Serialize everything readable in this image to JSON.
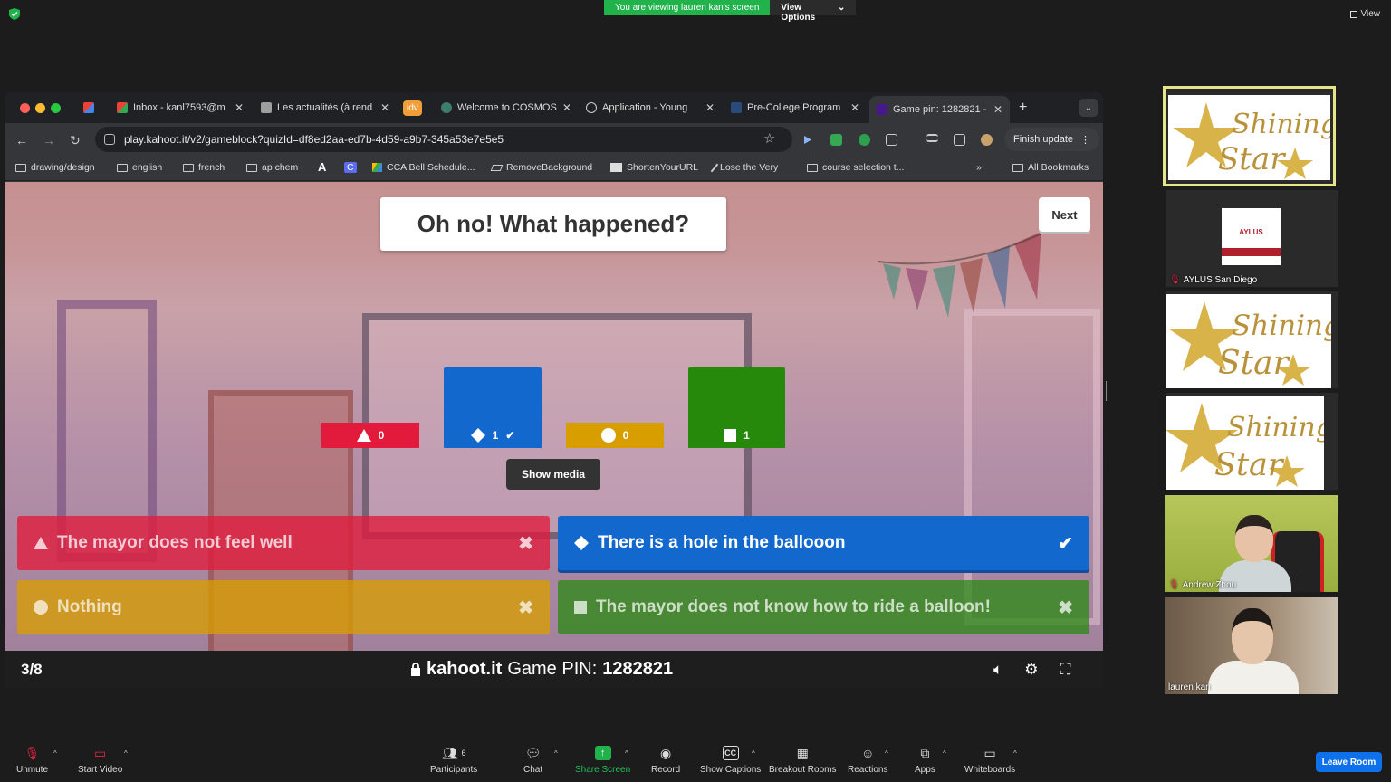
{
  "zoom_top": {
    "viewing_text": "You are viewing lauren kan's screen",
    "view_options": "View Options",
    "view_label": "View"
  },
  "browser": {
    "tabs": [
      {
        "label": "",
        "icon": "gmail-icon"
      },
      {
        "label": "Inbox - kanl7593@m",
        "icon": "gmail-icon"
      },
      {
        "label": "Les actualités (à rend",
        "icon": "classroom-icon"
      },
      {
        "label": "idv",
        "icon": "idv-icon"
      },
      {
        "label": "Welcome to COSMOS",
        "icon": "cosmos-icon"
      },
      {
        "label": "Application - Young",
        "icon": "globe-icon"
      },
      {
        "label": "Pre-College Program",
        "icon": "page-icon"
      },
      {
        "label": "Game pin: 1282821 -",
        "icon": "kahoot-icon"
      }
    ],
    "url": "play.kahoot.it/v2/gameblock?quizId=df8ed2aa-ed7b-4d59-a9b7-345a53e7e5e5",
    "finish_update": "Finish update",
    "bookmarks": [
      "drawing/design",
      "english",
      "french",
      "ap chem",
      "A",
      "C",
      "CCA Bell Schedule...",
      "RemoveBackground",
      "ShortenYourURL",
      "Lose the Very",
      "course selection t...",
      "All Bookmarks"
    ]
  },
  "kahoot": {
    "question": "Oh no! What happened?",
    "next_label": "Next",
    "show_media_label": "Show media",
    "results": [
      {
        "shape": "triangle",
        "count": "0",
        "color": "#e21b3c",
        "correct": false
      },
      {
        "shape": "diamond",
        "count": "1",
        "color": "#1368ce",
        "correct": true
      },
      {
        "shape": "circle",
        "count": "0",
        "color": "#d89e00",
        "correct": false
      },
      {
        "shape": "square",
        "count": "1",
        "color": "#26890c",
        "correct": false
      }
    ],
    "answers": [
      {
        "text": "The mayor does not feel well",
        "shape": "triangle",
        "mark": "✖"
      },
      {
        "text": "There is a hole in the ballooon",
        "shape": "diamond",
        "mark": "✔"
      },
      {
        "text": "Nothing",
        "shape": "circle",
        "mark": "✖"
      },
      {
        "text": "The mayor does not know how to ride a balloon!",
        "shape": "square",
        "mark": "✖"
      }
    ],
    "progress": "3/8",
    "site": "kahoot.it",
    "pin_label": "Game PIN:",
    "pin": "1282821"
  },
  "participants": [
    {
      "name": "",
      "type": "shining-star"
    },
    {
      "name": "AYLUS San Diego",
      "type": "logo"
    },
    {
      "name": "",
      "type": "shining-star"
    },
    {
      "name": "",
      "type": "shining-star"
    },
    {
      "name": "Andrew Zhou",
      "type": "video"
    },
    {
      "name": "lauren kan",
      "type": "video"
    }
  ],
  "shining_star_text": [
    "Shining",
    "Star"
  ],
  "aylus_logo_text": "AYLUS",
  "zoom_bar": {
    "unmute": "Unmute",
    "start_video": "Start Video",
    "participants": "Participants",
    "participants_count": "6",
    "chat": "Chat",
    "share_screen": "Share Screen",
    "record": "Record",
    "show_captions": "Show Captions",
    "breakout_rooms": "Breakout Rooms",
    "reactions": "Reactions",
    "apps": "Apps",
    "whiteboards": "Whiteboards",
    "leave_room": "Leave Room"
  }
}
